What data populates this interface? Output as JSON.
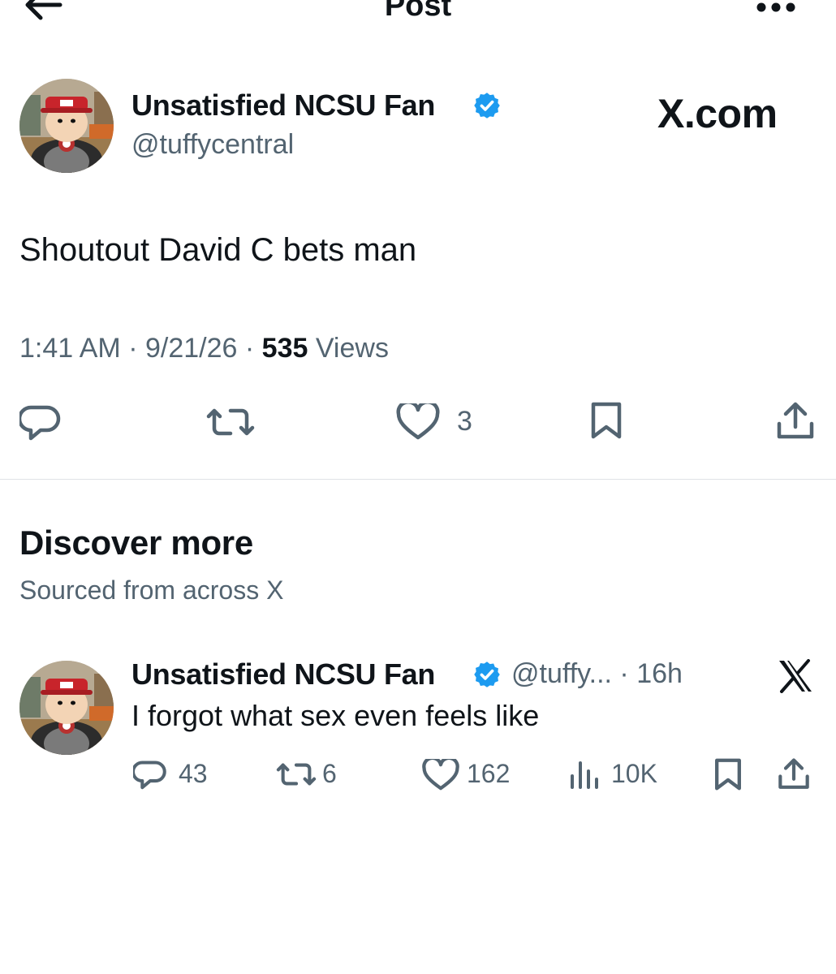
{
  "topbar": {
    "title": "Post"
  },
  "post": {
    "author_name": "Unsatisfied NCSU Fan",
    "handle": "@tuffycentral",
    "brand": "X.com",
    "text": "Shoutout David C bets man",
    "time": "1:41 AM",
    "date": "9/21/26",
    "views_count": "535",
    "views_label": "Views",
    "likes": "3"
  },
  "discover": {
    "title": "Discover more",
    "subtitle": "Sourced from across X"
  },
  "feed_item": {
    "author_name": "Unsatisfied NCSU Fan",
    "handle": "@tuffy...",
    "age": "16h",
    "text": "I forgot what sex even feels like",
    "replies": "43",
    "reposts": "6",
    "likes": "162",
    "views": "10K"
  },
  "colors": {
    "text": "#0f1419",
    "muted": "#536471",
    "verified": "#1d9bf0",
    "divider": "#dfe3e6"
  },
  "icons": [
    "back-arrow-icon",
    "more-icon",
    "verified-icon",
    "reply-icon",
    "repost-icon",
    "like-icon",
    "bookmark-icon",
    "share-icon",
    "views-icon",
    "x-logo-icon"
  ]
}
